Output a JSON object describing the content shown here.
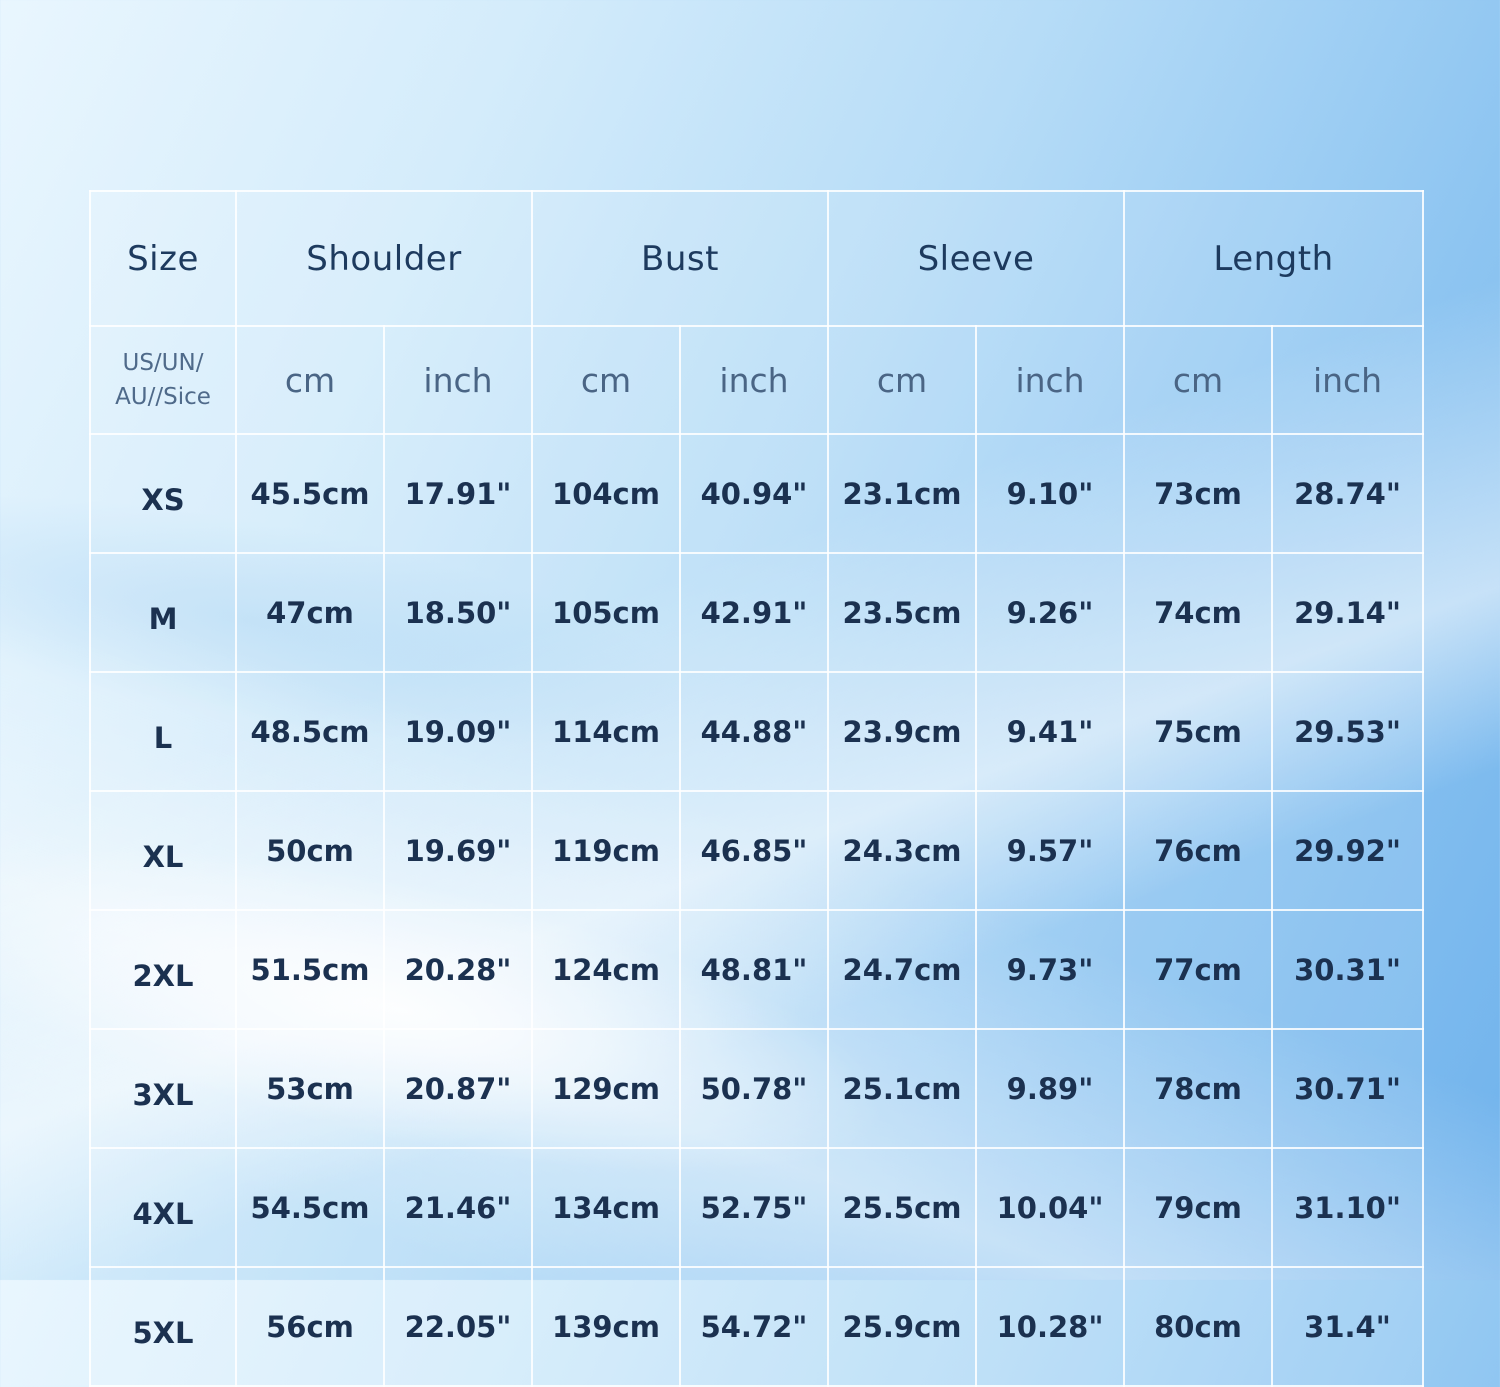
{
  "table": {
    "size_header": "Size",
    "groups": [
      "Shoulder",
      "Bust",
      "Sleeve",
      "Length"
    ],
    "size_label_lines": [
      "US/UN/",
      "AU//Sice"
    ],
    "units": [
      "cm",
      "inch",
      "cm",
      "inch",
      "cm",
      "inch",
      "cm",
      "inch"
    ],
    "rows": [
      {
        "size": "XS",
        "cells": [
          "45.5cm",
          "17.91\"",
          "104cm",
          "40.94\"",
          "23.1cm",
          "9.10\"",
          "73cm",
          "28.74\""
        ]
      },
      {
        "size": "M",
        "cells": [
          "47cm",
          "18.50\"",
          "105cm",
          "42.91\"",
          "23.5cm",
          "9.26\"",
          "74cm",
          "29.14\""
        ]
      },
      {
        "size": "L",
        "cells": [
          "48.5cm",
          "19.09\"",
          "114cm",
          "44.88\"",
          "23.9cm",
          "9.41\"",
          "75cm",
          "29.53\""
        ]
      },
      {
        "size": "XL",
        "cells": [
          "50cm",
          "19.69\"",
          "119cm",
          "46.85\"",
          "24.3cm",
          "9.57\"",
          "76cm",
          "29.92\""
        ]
      },
      {
        "size": "2XL",
        "cells": [
          "51.5cm",
          "20.28\"",
          "124cm",
          "48.81\"",
          "24.7cm",
          "9.73\"",
          "77cm",
          "30.31\""
        ]
      },
      {
        "size": "3XL",
        "cells": [
          "53cm",
          "20.87\"",
          "129cm",
          "50.78\"",
          "25.1cm",
          "9.89\"",
          "78cm",
          "30.71\""
        ]
      },
      {
        "size": "4XL",
        "cells": [
          "54.5cm",
          "21.46\"",
          "134cm",
          "52.75\"",
          "25.5cm",
          "10.04\"",
          "79cm",
          "31.10\""
        ]
      },
      {
        "size": "5XL",
        "cells": [
          "56cm",
          "22.05\"",
          "139cm",
          "54.72\"",
          "25.9cm",
          "10.28\"",
          "80cm",
          "31.4\""
        ]
      }
    ]
  },
  "colors": {
    "text": "#1b3150",
    "grid": "#ffffff",
    "background_start": "#e9f6fe",
    "background_end": "#6fb2ec"
  }
}
